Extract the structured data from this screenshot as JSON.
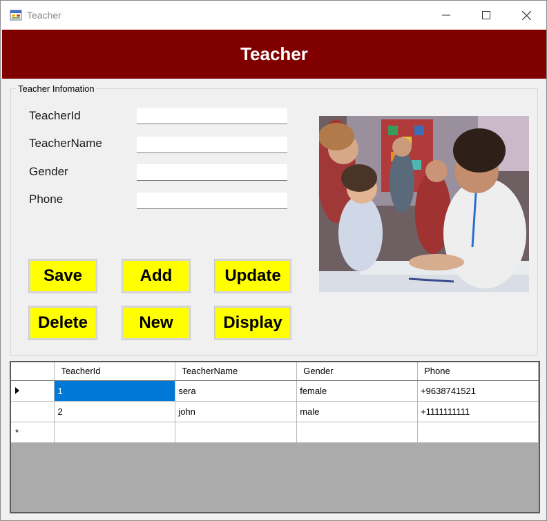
{
  "window": {
    "title": "Teacher",
    "icon": "form-app-icon"
  },
  "header": {
    "title": "Teacher"
  },
  "group": {
    "legend": "Teacher Infomation"
  },
  "form": {
    "fields": [
      {
        "label": "TeacherId",
        "value": ""
      },
      {
        "label": "TeacherName",
        "value": ""
      },
      {
        "label": "Gender",
        "value": ""
      },
      {
        "label": "Phone",
        "value": ""
      }
    ]
  },
  "photo": {
    "description": "teacher-with-students-image"
  },
  "buttons": {
    "save": "Save",
    "add": "Add",
    "update": "Update",
    "delete": "Delete",
    "new": "New",
    "display": "Display"
  },
  "grid": {
    "columns": [
      "TeacherId",
      "TeacherName",
      "Gender",
      "Phone"
    ],
    "rows": [
      {
        "id": "1",
        "name": "sera",
        "gender": "female",
        "phone": "+9638741521"
      },
      {
        "id": "2",
        "name": "john",
        "gender": "male",
        "phone": "+1111111111"
      }
    ],
    "new_row_marker": "*"
  },
  "colors": {
    "banner": "#800000",
    "button": "#ffff00",
    "selection": "#0078d7"
  }
}
